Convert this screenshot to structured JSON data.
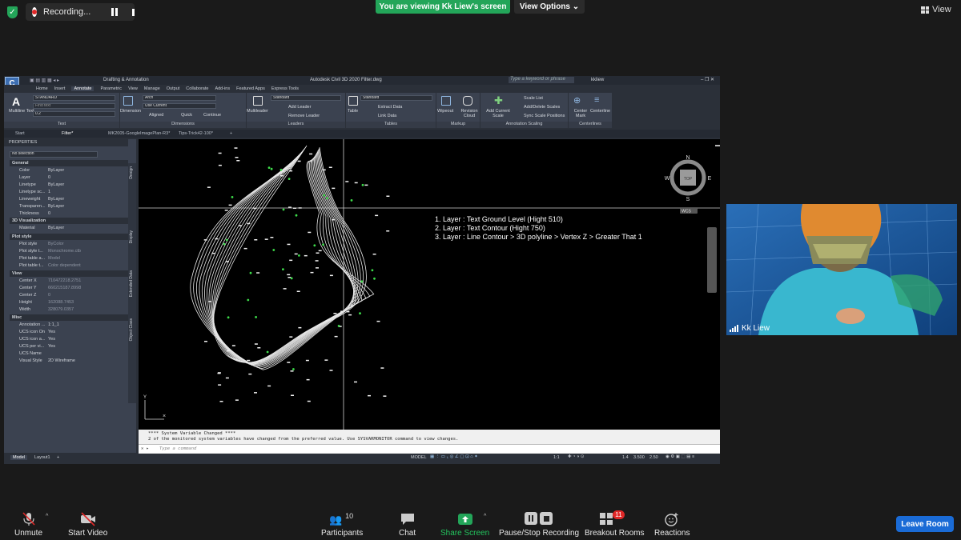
{
  "zoom": {
    "recording_label": "Recording...",
    "viewing_banner": "You are viewing Kk Liew's screen",
    "view_options": "View Options",
    "view_label": "View",
    "participant_count": "10",
    "breakout_badge": "11",
    "participant_name": "Kk Liew",
    "toolbar": {
      "unmute": "Unmute",
      "start_video": "Start Video",
      "participants": "Participants",
      "chat": "Chat",
      "share_screen": "Share Screen",
      "pause_stop": "Pause/Stop Recording",
      "breakout": "Breakout Rooms",
      "reactions": "Reactions",
      "leave": "Leave Room"
    },
    "colors": {
      "green": "#23a559",
      "blue": "#1a6bd6",
      "red": "#e02828"
    }
  },
  "cad": {
    "window_title": "Autodesk Civil 3D 2020   Filter.dwg",
    "workspace": "Drafting & Annotation",
    "search_placeholder": "Type a keyword or phrase",
    "user": "kkliew",
    "tabs": [
      "Home",
      "Insert",
      "Annotate",
      "Parametric",
      "View",
      "Manage",
      "Output",
      "Collaborate",
      "Add-ins",
      "Featured Apps",
      "Express Tools"
    ],
    "active_tab": "Annotate",
    "ribbon": {
      "text_group": {
        "label": "Text",
        "big": "Multiline Text",
        "style": "STANDARD",
        "find": "Find text",
        "height": "0.2"
      },
      "dim_group": {
        "label": "Dimensions",
        "big": "Dimension",
        "style": "Arch",
        "layer": "Use Current",
        "aligned": "Aligned",
        "quick": "Quick",
        "continue": "Continue"
      },
      "leader_group": {
        "label": "Leaders",
        "big": "Multileader",
        "style": "Standard",
        "add": "Add Leader",
        "remove": "Remove Leader"
      },
      "table_group": {
        "label": "Tables",
        "big": "Table",
        "style": "Standard",
        "extract": "Extract Data",
        "link": "Link Data"
      },
      "markup_group": {
        "label": "Markup",
        "wipeout": "Wipeout",
        "cloud": "Revision Cloud"
      },
      "scale_group": {
        "label": "Annotation Scaling",
        "add": "Add Current Scale",
        "list": "Scale List",
        "adddel": "Add/Delete Scales",
        "sync": "Sync Scale Positions"
      },
      "center_group": {
        "label": "Centerlines",
        "mark": "Center Mark",
        "line": "Centerline"
      }
    },
    "doc_tabs": [
      "Start",
      "Filter*",
      "MK2005-GoogleImagePlan-R3*",
      "Tips-Trick42-100*"
    ],
    "properties": {
      "header": "PROPERTIES",
      "selection": "No selection",
      "sections": {
        "general": "General",
        "viz": "3D Visualization",
        "plot": "Plot style",
        "view": "View",
        "misc": "Misc"
      },
      "general_rows": [
        [
          "Color",
          "ByLayer"
        ],
        [
          "Layer",
          "0"
        ],
        [
          "Linetype",
          "ByLayer"
        ],
        [
          "Linetype sc...",
          "1"
        ],
        [
          "Lineweight",
          "ByLayer"
        ],
        [
          "Transparen...",
          "ByLayer"
        ],
        [
          "Thickness",
          "0"
        ]
      ],
      "viz_rows": [
        [
          "Material",
          "ByLayer"
        ]
      ],
      "plot_rows": [
        [
          "Plot style",
          "ByColor"
        ],
        [
          "Plot style t...",
          "Monochrome.ctb"
        ],
        [
          "Plot table a...",
          "Model"
        ],
        [
          "Plot table t...",
          "Color dependent"
        ]
      ],
      "view_rows": [
        [
          "Center X",
          "710472218.2751"
        ],
        [
          "Center Y",
          "660215187.8998"
        ],
        [
          "Center Z",
          "0"
        ],
        [
          "Height",
          "162088.7453"
        ],
        [
          "Width",
          "328079.0357"
        ]
      ],
      "misc_rows": [
        [
          "Annotation ...",
          "1:1_1"
        ],
        [
          "UCS icon On",
          "Yes"
        ],
        [
          "UCS icon a...",
          "Yes"
        ],
        [
          "UCS per vi...",
          "Yes"
        ],
        [
          "UCS Name",
          ""
        ],
        [
          "Visual Style",
          "2D Wireframe"
        ]
      ],
      "side_tabs": [
        "Design",
        "Display",
        "Extended Data",
        "Object Class"
      ]
    },
    "notes": [
      "1.    Layer : Text Ground Level (Hight 510)",
      "2.    Layer : Text Contour  (Hight 750)",
      "3.    Layer : Line Contour > 3D polyline > Vertex Z > Greater That 1"
    ],
    "viewcube": {
      "n": "N",
      "s": "S",
      "e": "E",
      "w": "W",
      "top": "TOP",
      "wcs": "WCS"
    },
    "axis": {
      "y": "Y"
    },
    "command_history": [
      "**** System Variable Changed ****",
      "2 of the monitored system variables have changed from the preferred value. Use SYSVARMONITOR command to view changes."
    ],
    "command_placeholder": "Type a command",
    "layout_tabs": [
      "Model",
      "Layout1"
    ],
    "status": {
      "model": "MODEL",
      "scale": "1:1",
      "values": [
        "1.4",
        "3.500",
        "2.50"
      ]
    }
  }
}
